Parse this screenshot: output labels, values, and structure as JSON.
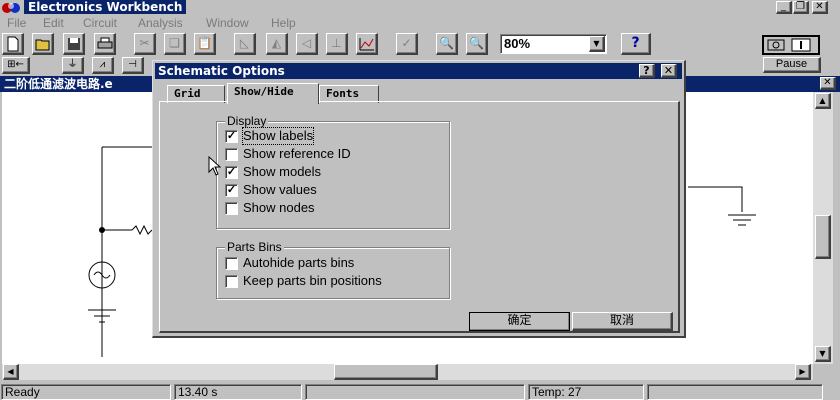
{
  "app": {
    "title": "Electronics Workbench",
    "minimize": "_",
    "restore": "🗗",
    "close": "✕"
  },
  "menu": [
    "File",
    "Edit",
    "Circuit",
    "Analysis",
    "Window",
    "Help"
  ],
  "toolbar": {
    "zoom": "80%",
    "help": "?",
    "power": "O | I",
    "pause": "Pause"
  },
  "document": {
    "title": "二阶低通滤波电路.e",
    "close": "✕"
  },
  "dialog": {
    "title": "Schematic Options",
    "help_button": "?",
    "close_button": "✕",
    "tabs": [
      "Grid",
      "Show/Hide",
      "Fonts"
    ],
    "active_tab": "Show/Hide",
    "display_group": {
      "label": "Display",
      "items": [
        {
          "label": "Show labels",
          "checked": true,
          "focused": true
        },
        {
          "label": "Show reference ID",
          "checked": false
        },
        {
          "label": "Show models",
          "checked": true
        },
        {
          "label": "Show values",
          "checked": true
        },
        {
          "label": "Show nodes",
          "checked": false
        }
      ]
    },
    "parts_group": {
      "label": "Parts Bins",
      "items": [
        {
          "label": "Autohide parts bins",
          "checked": false
        },
        {
          "label": "Keep parts bin positions",
          "checked": false
        }
      ]
    },
    "ok_label": "确定",
    "cancel_label": "取消"
  },
  "status": {
    "state": "Ready",
    "time": "13.40 s",
    "temp": "Temp:  27"
  },
  "colors": {
    "title_active": "#0a246a",
    "face": "#c0c0c0",
    "disabled_text": "#7a7a7a"
  }
}
